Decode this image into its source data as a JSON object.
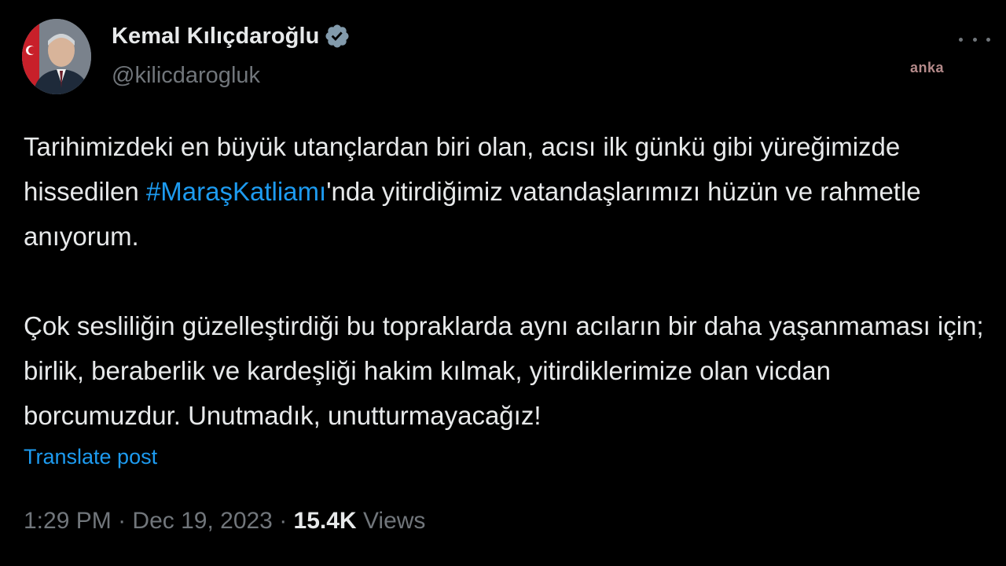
{
  "author": {
    "name": "Kemal Kılıçdaroğlu",
    "handle": "@kilicdarogluk",
    "verified_color": "#829aab"
  },
  "watermark": "anka",
  "tweet": {
    "paragraph_1_a": "Tarihimizdeki en büyük utançlardan biri olan, acısı ilk günkü gibi yüreğimizde hissedilen ",
    "hashtag": "#MaraşKatliamı",
    "paragraph_1_b": "'nda yitirdiğimiz vatandaşlarımızı hüzün ve rahmetle anıyorum.",
    "paragraph_2": "Çok sesliliğin güzelleştirdiği bu topraklarda aynı acıların bir daha yaşanmaması için; birlik, beraberlik ve kardeşliği hakim kılmak, yitirdiklerimize olan vicdan borcumuzdur. Unutmadık, unutturmayacağız!"
  },
  "translate_label": "Translate post",
  "meta": {
    "time": "1:29 PM",
    "separator": " · ",
    "date": "Dec 19, 2023",
    "views_count": "15.4K",
    "views_label": " Views"
  },
  "colors": {
    "background": "#000000",
    "text": "#e7e9ea",
    "secondary": "#71767b",
    "link": "#1d9bf0"
  },
  "icons": [
    "verified-badge-icon",
    "more-options-icon"
  ]
}
